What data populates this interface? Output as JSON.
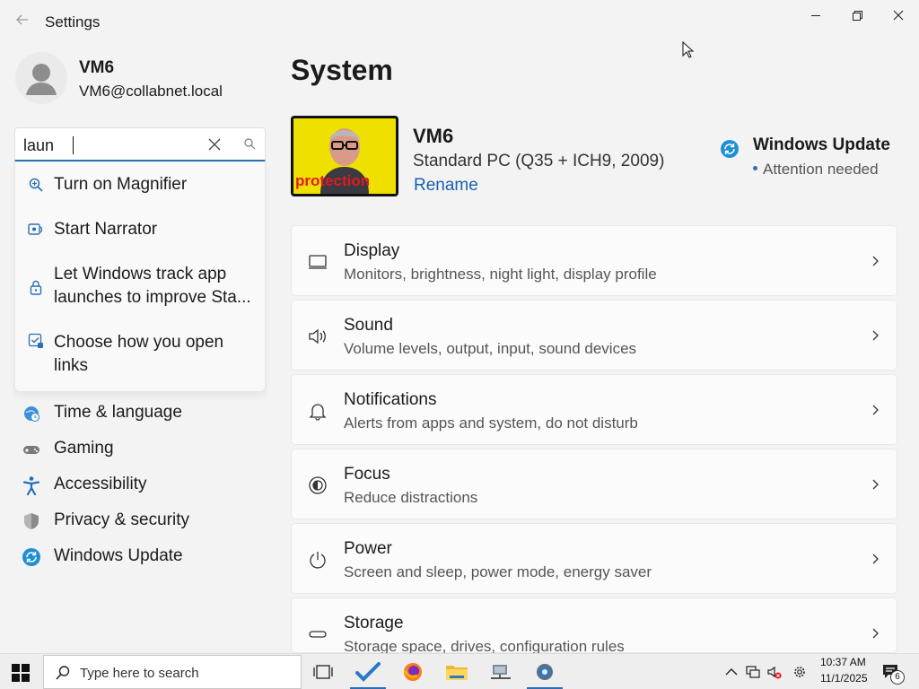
{
  "window": {
    "title": "Settings"
  },
  "account": {
    "name": "VM6",
    "email": "VM6@collabnet.local"
  },
  "search": {
    "value": "laun",
    "placeholder": ""
  },
  "suggestions": [
    {
      "label": "Turn on Magnifier",
      "icon": "magnifier-icon"
    },
    {
      "label": "Start Narrator",
      "icon": "narrator-icon"
    },
    {
      "label": "Let Windows track app launches to improve Sta...",
      "icon": "lock-icon"
    },
    {
      "label": "Choose how you open links",
      "icon": "default-apps-icon"
    }
  ],
  "nav": {
    "items": [
      {
        "label": "Time & language",
        "icon": "globe-clock-icon"
      },
      {
        "label": "Gaming",
        "icon": "gamepad-icon"
      },
      {
        "label": "Accessibility",
        "icon": "accessibility-icon"
      },
      {
        "label": "Privacy & security",
        "icon": "shield-icon"
      },
      {
        "label": "Windows Update",
        "icon": "update-icon"
      }
    ]
  },
  "main": {
    "title": "System",
    "device": {
      "name": "VM6",
      "model": "Standard PC (Q35 + ICH9, 2009)",
      "rename": "Rename",
      "image_caption": "protection"
    },
    "update": {
      "title": "Windows Update",
      "status": "Attention needed"
    },
    "cards": [
      {
        "title": "Display",
        "subtitle": "Monitors, brightness, night light, display profile",
        "icon": "monitor-icon"
      },
      {
        "title": "Sound",
        "subtitle": "Volume levels, output, input, sound devices",
        "icon": "speaker-icon"
      },
      {
        "title": "Notifications",
        "subtitle": "Alerts from apps and system, do not disturb",
        "icon": "bell-icon"
      },
      {
        "title": "Focus",
        "subtitle": "Reduce distractions",
        "icon": "focus-icon"
      },
      {
        "title": "Power",
        "subtitle": "Screen and sleep, power mode, energy saver",
        "icon": "power-icon"
      },
      {
        "title": "Storage",
        "subtitle": "Storage space, drives, configuration rules",
        "icon": "storage-icon"
      }
    ]
  },
  "taskbar": {
    "search_placeholder": "Type here to search",
    "time": "10:37 AM",
    "date": "11/1/2025",
    "notification_count": "6"
  },
  "colors": {
    "accent": "#2a6fb5",
    "link": "#1a5fb4",
    "background": "#f3f3f3"
  }
}
